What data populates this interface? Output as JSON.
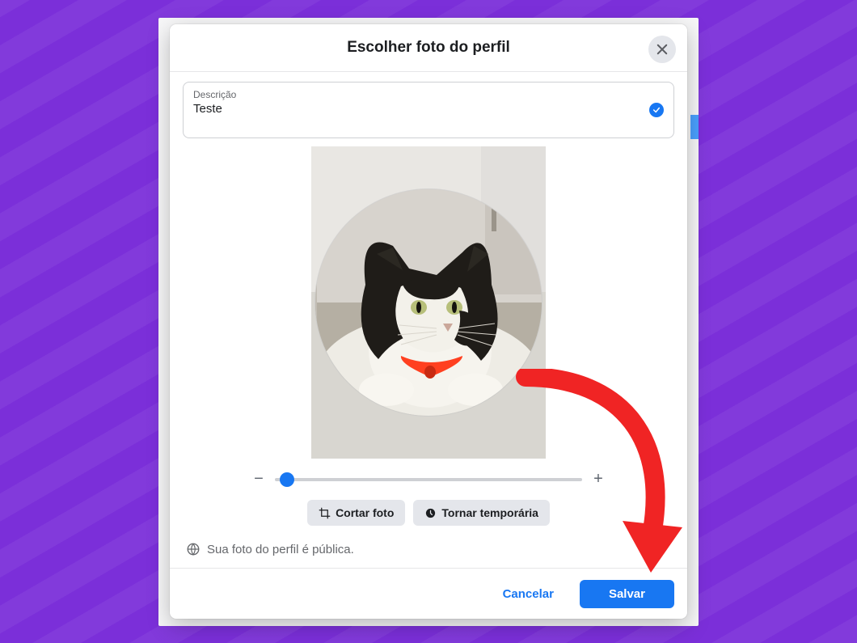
{
  "modal": {
    "title": "Escolher foto do perfil",
    "close_icon": "close"
  },
  "description": {
    "label": "Descrição",
    "value": "Teste",
    "validated": true
  },
  "zoom": {
    "minus": "−",
    "plus": "+",
    "value_percent": 4
  },
  "tools": {
    "crop_label": "Cortar foto",
    "temporary_label": "Tornar temporária"
  },
  "notice": {
    "text": "Sua foto do perfil é pública."
  },
  "footer": {
    "cancel_label": "Cancelar",
    "save_label": "Salvar"
  },
  "colors": {
    "accent": "#1877f2",
    "background_purple": "#7b2fd9",
    "annotation_red": "#f02424"
  },
  "preview": {
    "subject": "black-and-white-cat",
    "collar_color": "#ff4020"
  }
}
